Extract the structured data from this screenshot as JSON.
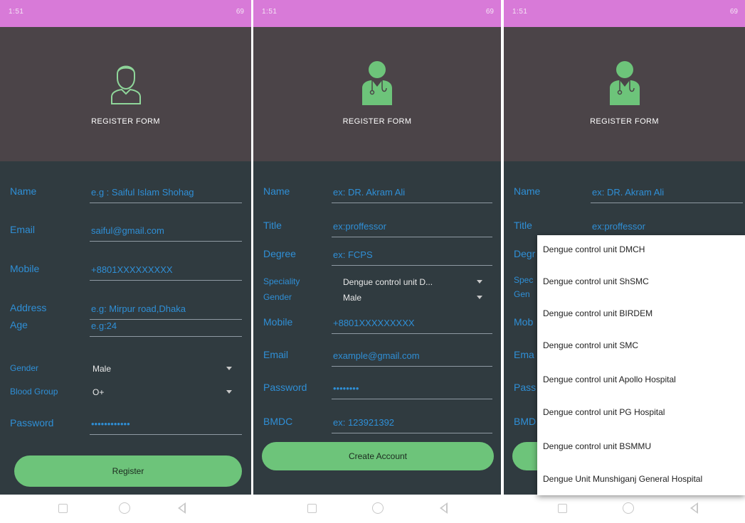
{
  "status": {
    "time": "1:51",
    "battery": "69"
  },
  "panel1": {
    "title": "REGISTER FORM",
    "fields": [
      {
        "label": "Name",
        "value": "e.g : Saiful Islam Shohag"
      },
      {
        "label": "Email",
        "value": "saiful@gmail.com"
      },
      {
        "label": "Mobile",
        "value": "+8801XXXXXXXXX"
      },
      {
        "label": "Address",
        "value": "e.g: Mirpur road,Dhaka"
      },
      {
        "label": "Age",
        "value": "e.g:24"
      }
    ],
    "gender": {
      "label": "Gender",
      "value": "Male"
    },
    "blood": {
      "label": "Blood Group",
      "value": "O+"
    },
    "password": {
      "label": "Password",
      "value": "••••••••••••"
    },
    "button": "Register"
  },
  "panel2": {
    "title": "REGISTER FORM",
    "fields": [
      {
        "label": "Name",
        "value": "ex: DR. Akram Ali"
      },
      {
        "label": "Title",
        "value": "ex:proffessor"
      },
      {
        "label": "Degree",
        "value": "ex: FCPS"
      }
    ],
    "speciality": {
      "label": "Speciality",
      "value": "Dengue control unit D..."
    },
    "gender": {
      "label": "Gender",
      "value": "Male"
    },
    "fields2": [
      {
        "label": "Mobile",
        "value": "+8801XXXXXXXXX"
      },
      {
        "label": "Email",
        "value": "example@gmail.com"
      },
      {
        "label": "Password",
        "value": "••••••••"
      },
      {
        "label": "BMDC",
        "value": "ex: 123921392"
      }
    ],
    "button": "Create Account"
  },
  "panel3": {
    "title": "REGISTER FORM",
    "name_value": "ex: DR. Akram Ali",
    "title_value": "ex:proffessor",
    "labels": [
      "Name",
      "Title",
      "Degr",
      "Spec",
      "Gen",
      "Mob",
      "Ema",
      "Pass",
      "BMD"
    ],
    "dropdown": [
      "Dengue control unit DMCH",
      "Dengue control unit ShSMC",
      "Dengue control unit BIRDEM",
      "Dengue control unit SMC",
      "Dengue control unit Apollo Hospital",
      "Dengue control unit PG Hospital",
      "Dengue control unit BSMMU",
      "Dengue Unit Munshiganj General Hospital"
    ]
  },
  "colors": {
    "accent": "#2f8fd6",
    "button": "#6dc47a",
    "statusbar": "#d87ad8",
    "header": "#4b4448",
    "form": "#303b40"
  },
  "icons": [
    "doctor-outline-icon",
    "doctor-filled-icon",
    "recent-apps-icon",
    "home-icon",
    "back-icon",
    "dropdown-arrow-icon"
  ]
}
